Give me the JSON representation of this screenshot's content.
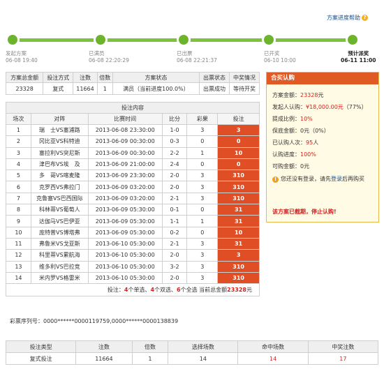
{
  "help": {
    "label": "方案进度帮助",
    "icon": "?"
  },
  "progress": {
    "steps": [
      {
        "label": "发起方案",
        "time": "06-08 19:40"
      },
      {
        "label": "已满员",
        "time": "06-08 22:20:29"
      },
      {
        "label": "已出票",
        "time": "06-08 22:21:37"
      },
      {
        "label": "已开奖",
        "time": "06-10 10:00"
      },
      {
        "label": "预计派奖",
        "time": "06-11 11:00"
      }
    ]
  },
  "summary": {
    "headers": [
      "方案总金额",
      "投注方式",
      "注数",
      "倍数",
      "方案状态",
      "出票状态",
      "中奖情况"
    ],
    "row": [
      "23328",
      "复式",
      "11664",
      "1",
      "满员（当前进度100.0%）",
      "出票成功",
      "等待开奖"
    ]
  },
  "bets": {
    "caption": "投注内容",
    "headers": [
      "场次",
      "对阵",
      "比赛时间",
      "比分",
      "彩果",
      "投注"
    ],
    "rows": [
      [
        "1",
        "瑞　士VS塞浦路",
        "2013-06-08 23:30:00",
        "1-0",
        "3",
        "3"
      ],
      [
        "2",
        "冈比亚VS科特迪",
        "2013-06-09 00:30:00",
        "0-3",
        "0",
        "0"
      ],
      [
        "3",
        "塞拉利VS突尼斯",
        "2013-06-09 00:30:00",
        "2-2",
        "1",
        "10"
      ],
      [
        "4",
        "津巴布VS埃　及",
        "2013-06-09 21:00:00",
        "2-4",
        "0",
        "0"
      ],
      [
        "5",
        "多　哥VS喀麦隆",
        "2013-06-09 23:30:00",
        "2-0",
        "3",
        "310"
      ],
      [
        "6",
        "克罗西VS弗拉门",
        "2013-06-09 03:20:00",
        "2-0",
        "3",
        "310"
      ],
      [
        "7",
        "克鲁塞VS巴西国际",
        "2013-06-09 03:20:00",
        "2-1",
        "3",
        "310"
      ],
      [
        "8",
        "科林蒂VS葡萄人",
        "2013-06-09 05:30:00",
        "0-1",
        "0",
        "31"
      ],
      [
        "9",
        "达伽马VS巴伊亚",
        "2013-06-09 05:30:00",
        "1-1",
        "1",
        "31"
      ],
      [
        "10",
        "庞特普VS博塔弗",
        "2013-06-09 05:30:00",
        "0-2",
        "0",
        "10"
      ],
      [
        "11",
        "弗鲁米VS戈亚斯",
        "2013-06-10 05:30:00",
        "2-1",
        "3",
        "31"
      ],
      [
        "12",
        "科里蒂VS累航海",
        "2013-06-10 05:30:00",
        "2-0",
        "3",
        "3"
      ],
      [
        "13",
        "维多利VS巴拉竞",
        "2013-06-10 05:30:00",
        "3-2",
        "3",
        "310"
      ],
      [
        "14",
        "米内罗VS格雷米",
        "2013-06-10 05:30:00",
        "2-0",
        "3",
        "310"
      ]
    ],
    "footer": {
      "prefix": "投注：",
      "single": "4",
      "single_label": "个单选、",
      "double": "4",
      "double_label": "个双选、",
      "full": "6",
      "full_label": "个全选 当前总金额",
      "total": "23328",
      "unit": "元"
    }
  },
  "serial": "彩票序列号：0000******0000119759,0000******0000138839",
  "buy": {
    "title": "合买认购",
    "total_label": "方案金额：",
    "total": "23328",
    "total_unit": "元",
    "sponsor_label": "发起人认购：",
    "sponsor": "¥18,000.00元",
    "sponsor_pct": "（77%）",
    "commission_label": "提成比例：",
    "commission": "10%",
    "guarantee_label": "保底金额：",
    "guarantee": "0元（0%）",
    "buyers_label": "已认购人次：",
    "buyers": "95",
    "buyers_unit": "人",
    "progress_label": "认购进度：",
    "progress": "100%",
    "available_label": "可购金额：",
    "available": "0元",
    "login_prefix": "您还没有登录，请先",
    "login_link": "登录",
    "login_suffix": "后再购买",
    "closed": "该方案已截期，停止认购!"
  },
  "bottom": {
    "headers": [
      "投注类型",
      "注数",
      "倍数",
      "选择场数",
      "命中场数",
      "中奖注数"
    ],
    "row": [
      "复式投注",
      "11664",
      "1",
      "14",
      "14",
      "17"
    ]
  },
  "colors": {
    "accent_green": "#6bb42c",
    "accent_red": "#e04e26",
    "link_blue": "#1a4f8b"
  }
}
